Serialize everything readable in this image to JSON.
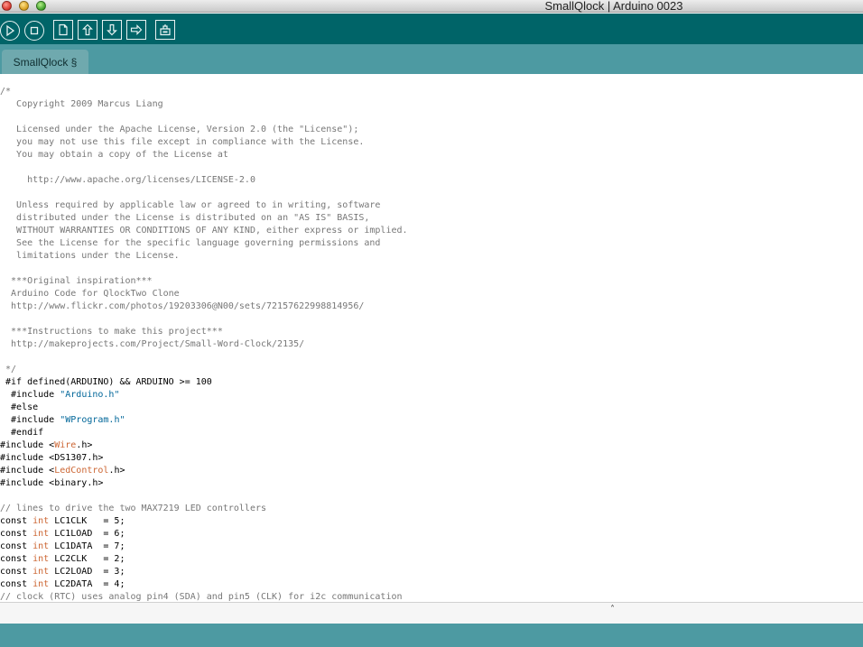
{
  "window": {
    "title": "SmallQlock | Arduino 0023"
  },
  "toolbar": {
    "buttons": [
      {
        "name": "verify",
        "icon": "play-icon"
      },
      {
        "name": "stop",
        "icon": "stop-icon"
      },
      {
        "name": "new",
        "icon": "new-document-icon"
      },
      {
        "name": "open",
        "icon": "open-arrow-up-icon"
      },
      {
        "name": "save",
        "icon": "save-arrow-down-icon"
      },
      {
        "name": "upload",
        "icon": "upload-arrow-right-icon"
      },
      {
        "name": "serial-monitor",
        "icon": "serial-monitor-icon"
      }
    ]
  },
  "tabs": [
    {
      "label": "SmallQlock §"
    }
  ],
  "editor": {
    "lines": [
      [
        {
          "t": "/*",
          "c": "cm"
        }
      ],
      [
        {
          "t": "   Copyright 2009 Marcus Liang",
          "c": "cm"
        }
      ],
      [],
      [
        {
          "t": "   Licensed under the Apache License, Version 2.0 (the \"License\");",
          "c": "cm"
        }
      ],
      [
        {
          "t": "   you may not use this file except in compliance with the License.",
          "c": "cm"
        }
      ],
      [
        {
          "t": "   You may obtain a copy of the License at",
          "c": "cm"
        }
      ],
      [],
      [
        {
          "t": "     http://www.apache.org/licenses/LICENSE-2.0",
          "c": "cm"
        }
      ],
      [],
      [
        {
          "t": "   Unless required by applicable law or agreed to in writing, software",
          "c": "cm"
        }
      ],
      [
        {
          "t": "   distributed under the License is distributed on an \"AS IS\" BASIS,",
          "c": "cm"
        }
      ],
      [
        {
          "t": "   WITHOUT WARRANTIES OR CONDITIONS OF ANY KIND, either express or implied.",
          "c": "cm"
        }
      ],
      [
        {
          "t": "   See the License for the specific language governing permissions and",
          "c": "cm"
        }
      ],
      [
        {
          "t": "   limitations under the License.",
          "c": "cm"
        }
      ],
      [],
      [
        {
          "t": "  ***Original inspiration***",
          "c": "cm"
        }
      ],
      [
        {
          "t": "  Arduino Code for QlockTwo Clone",
          "c": "cm"
        }
      ],
      [
        {
          "t": "  http://www.flickr.com/photos/19203306@N00/sets/72157622998814956/",
          "c": "cm"
        }
      ],
      [],
      [
        {
          "t": "  ***Instructions to make this project***",
          "c": "cm"
        }
      ],
      [
        {
          "t": "  http://makeprojects.com/Project/Small-Word-Clock/2135/",
          "c": "cm"
        }
      ],
      [],
      [
        {
          "t": " */",
          "c": "cm"
        }
      ],
      [
        {
          "t": " #if defined(ARDUINO) && ARDUINO >= 100",
          "c": ""
        }
      ],
      [
        {
          "t": "  #include ",
          "c": ""
        },
        {
          "t": "\"Arduino.h\"",
          "c": "str"
        }
      ],
      [
        {
          "t": "  #else",
          "c": ""
        }
      ],
      [
        {
          "t": "  #include ",
          "c": ""
        },
        {
          "t": "\"WProgram.h\"",
          "c": "str"
        }
      ],
      [
        {
          "t": "  #endif",
          "c": ""
        }
      ],
      [
        {
          "t": "#include <",
          "c": ""
        },
        {
          "t": "Wire",
          "c": "lib"
        },
        {
          "t": ".h>",
          "c": ""
        }
      ],
      [
        {
          "t": "#include <DS1307.h>",
          "c": ""
        }
      ],
      [
        {
          "t": "#include <",
          "c": ""
        },
        {
          "t": "LedControl",
          "c": "lib"
        },
        {
          "t": ".h>",
          "c": ""
        }
      ],
      [
        {
          "t": "#include <binary.h>",
          "c": ""
        }
      ],
      [],
      [
        {
          "t": "// lines to drive the two MAX7219 LED controllers",
          "c": "cm"
        }
      ],
      [
        {
          "t": "const ",
          "c": ""
        },
        {
          "t": "int",
          "c": "kw"
        },
        {
          "t": " LC1CLK   = 5;",
          "c": ""
        }
      ],
      [
        {
          "t": "const ",
          "c": ""
        },
        {
          "t": "int",
          "c": "kw"
        },
        {
          "t": " LC1LOAD  = 6;",
          "c": ""
        }
      ],
      [
        {
          "t": "const ",
          "c": ""
        },
        {
          "t": "int",
          "c": "kw"
        },
        {
          "t": " LC1DATA  = 7;",
          "c": ""
        }
      ],
      [
        {
          "t": "const ",
          "c": ""
        },
        {
          "t": "int",
          "c": "kw"
        },
        {
          "t": " LC2CLK   = 2;",
          "c": ""
        }
      ],
      [
        {
          "t": "const ",
          "c": ""
        },
        {
          "t": "int",
          "c": "kw"
        },
        {
          "t": " LC2LOAD  = 3;",
          "c": ""
        }
      ],
      [
        {
          "t": "const ",
          "c": ""
        },
        {
          "t": "int",
          "c": "kw"
        },
        {
          "t": " LC2DATA  = 4;",
          "c": ""
        }
      ],
      [
        {
          "t": "// clock (RTC) uses analog pin4 (SDA) and pin5 (CLK) for i2c communication",
          "c": "cm"
        }
      ]
    ]
  },
  "splitter": {
    "glyph": "˄"
  },
  "colors": {
    "toolbar": "#006468",
    "tabbar": "#4d9aa2",
    "statusbar": "#4d9aa2",
    "comment": "#777777",
    "keyword": "#cc6633",
    "string": "#006699"
  }
}
